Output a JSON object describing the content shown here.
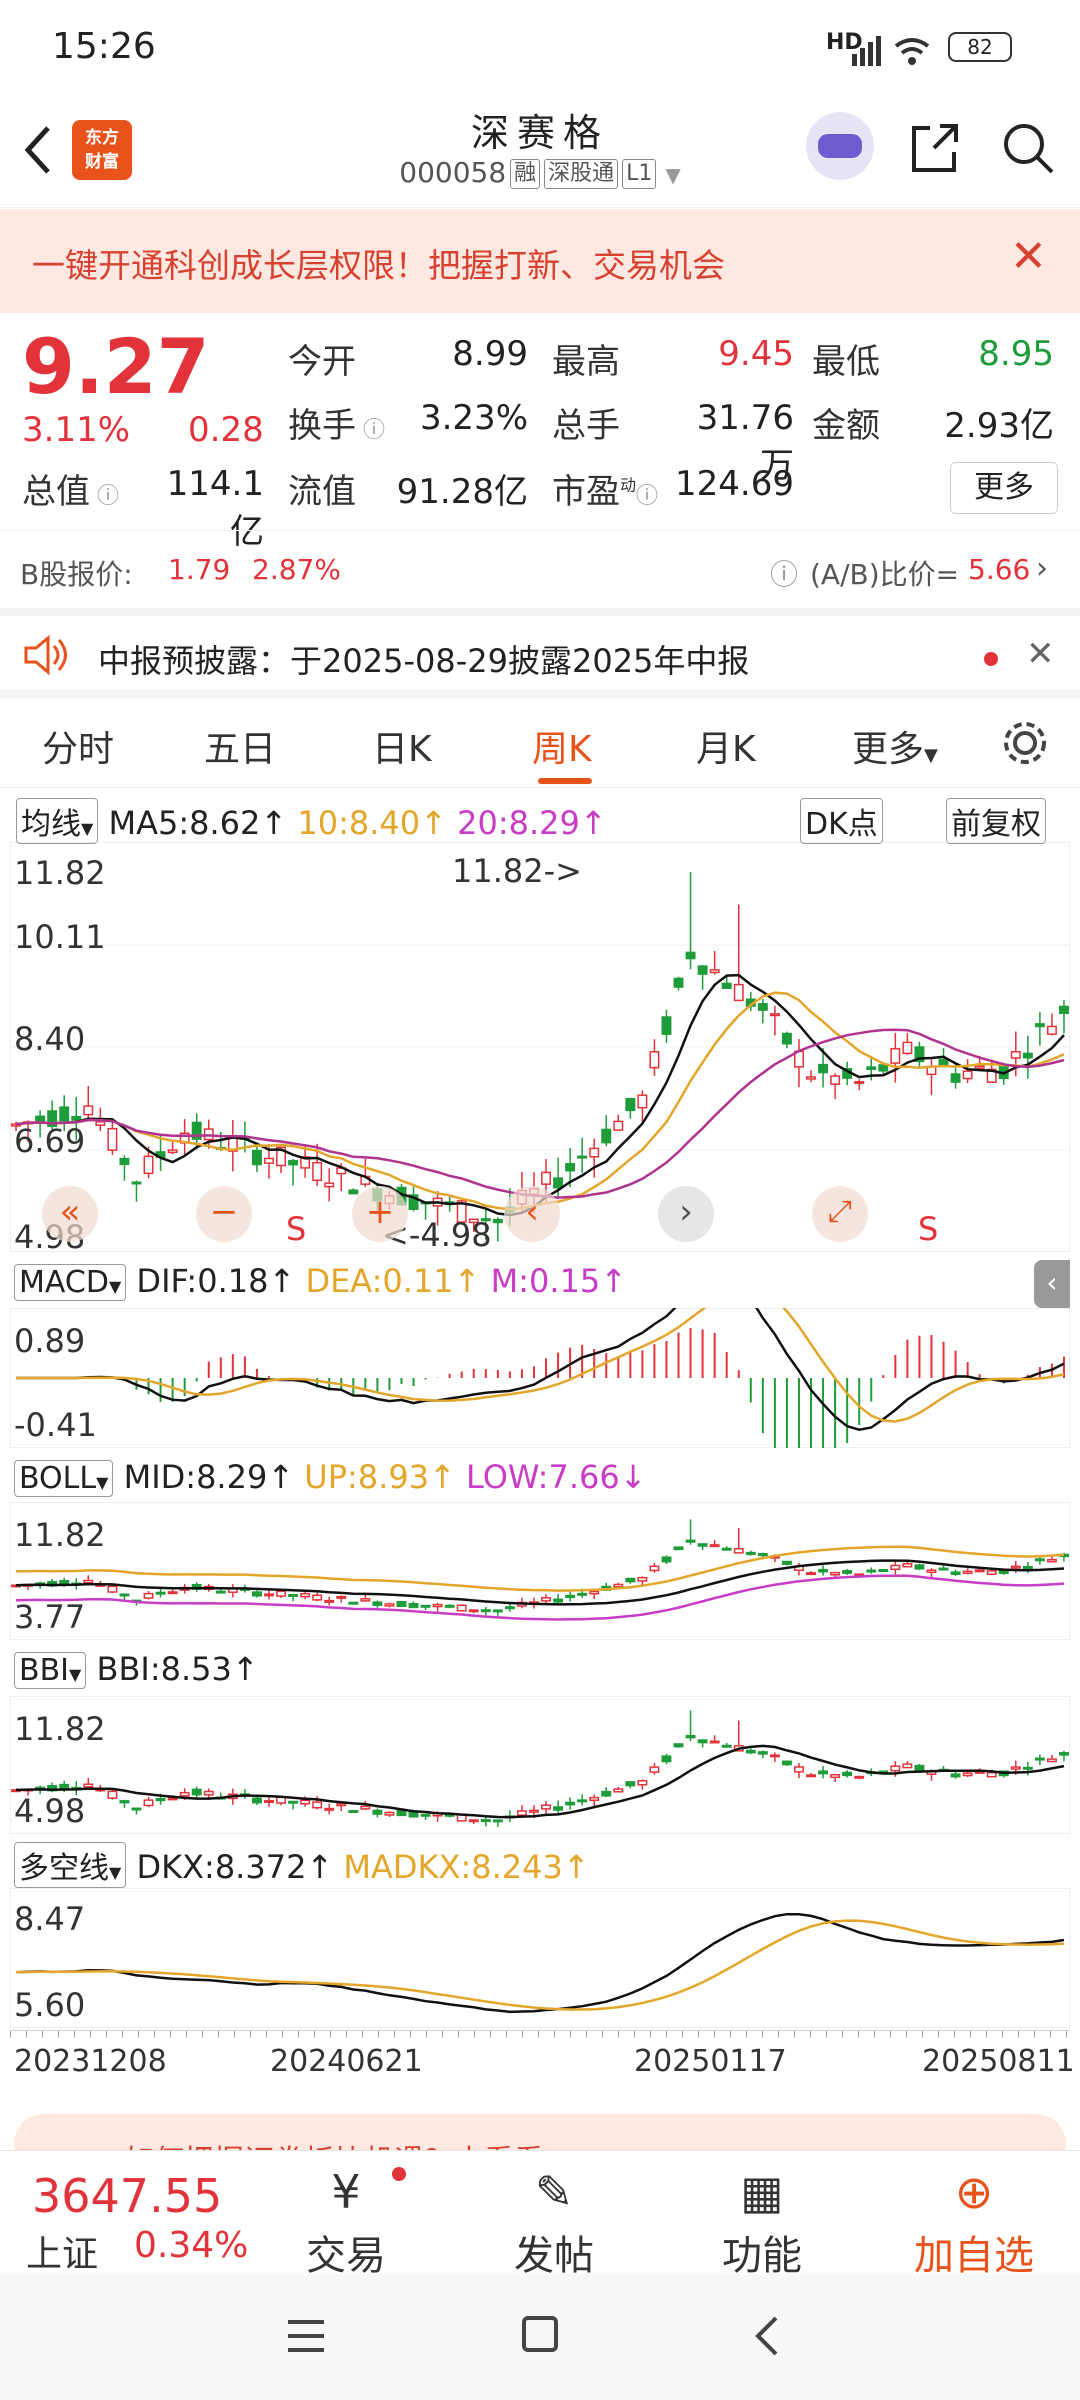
{
  "status_bar": {
    "time": "15:26",
    "signal": "HD",
    "battery": "82"
  },
  "header": {
    "title": "深赛格",
    "code": "000058",
    "tags": [
      "融",
      "深股通",
      "L1"
    ]
  },
  "banner": {
    "text": "一键开通科创成长层权限！把握打新、交易机会"
  },
  "quote": {
    "price": "9.27",
    "change_pct": "3.11%",
    "change": "0.28",
    "rows": [
      [
        {
          "label": "今开",
          "value": "8.99",
          "color": "#222222"
        },
        {
          "label": "最高",
          "value": "9.45",
          "color": "#e2333a"
        },
        {
          "label": "最低",
          "value": "8.95",
          "color": "#1f9c3a"
        }
      ],
      [
        {
          "label": "换手",
          "value": "3.23%",
          "color": "#222222"
        },
        {
          "label": "总手",
          "value": "31.76万",
          "color": "#222222"
        },
        {
          "label": "金额",
          "value": "2.93亿",
          "color": "#222222"
        }
      ]
    ],
    "total_value_label": "总值",
    "total_value": "114.1亿",
    "float_value_label": "流值",
    "float_value": "91.28亿",
    "pe_label": "市盈",
    "pe_sup": "动",
    "pe_value": "124.69",
    "more_label": "更多"
  },
  "b_quote": {
    "label": "B股报价:",
    "price": "1.79",
    "pct": "2.87%",
    "ratio_label": "(A/B)比价=",
    "ratio": "5.66"
  },
  "notice": {
    "text": "中报预披露：于2025-08-29披露2025年中报"
  },
  "tabs": [
    {
      "label": "分时",
      "active": false
    },
    {
      "label": "五日",
      "active": false
    },
    {
      "label": "日K",
      "active": false
    },
    {
      "label": "周K",
      "active": true
    },
    {
      "label": "月K",
      "active": false
    },
    {
      "label": "更多",
      "active": false
    }
  ],
  "ma_bar": {
    "selector": "均线",
    "ma5": "MA5:8.62",
    "ma10": "10:8.40",
    "ma20": "20:8.29",
    "dk": "DK点",
    "adjust": "前复权"
  },
  "kline": {
    "y_labels": [
      "11.82",
      "10.11",
      "8.40",
      "6.69",
      "4.98"
    ],
    "high_mark": "11.82->",
    "low_mark": "<-4.98",
    "s_marks": [
      "S",
      "S"
    ]
  },
  "macd": {
    "selector": "MACD",
    "dif": "DIF:0.18",
    "dea": "DEA:0.11",
    "m": "M:0.15",
    "y_labels": [
      "0.89",
      "-0.41"
    ]
  },
  "boll": {
    "selector": "BOLL",
    "mid": "MID:8.29",
    "up": "UP:8.93",
    "low": "LOW:7.66",
    "y_labels": [
      "11.82",
      "3.77"
    ]
  },
  "bbi": {
    "selector": "BBI",
    "bbi": "BBI:8.53",
    "y_labels": [
      "11.82",
      "4.98"
    ]
  },
  "dkx": {
    "selector": "多空线",
    "dkx": "DKX:8.372",
    "madkx": "MADKX:8.243",
    "y_labels": [
      "8.47",
      "5.60"
    ]
  },
  "dates": [
    "20231208",
    "20240621",
    "20250117",
    "20250811"
  ],
  "promo": {
    "text": "如何把握证券板块机遇？去看看>>"
  },
  "bottom_nav": {
    "index_value": "3647.55",
    "index_name": "上证",
    "index_pct": "0.34%",
    "items": [
      {
        "label": "交易",
        "icon": "¥"
      },
      {
        "label": "发帖",
        "icon": "✎"
      },
      {
        "label": "功能",
        "icon": "▦"
      },
      {
        "label": "加自选",
        "icon": "⊕"
      }
    ]
  },
  "colors": {
    "rise": "#e2333a",
    "fall": "#1f9c3a",
    "accent": "#e8531b",
    "ma10": "#e4a62a",
    "ma20": "#c83cc6"
  }
}
